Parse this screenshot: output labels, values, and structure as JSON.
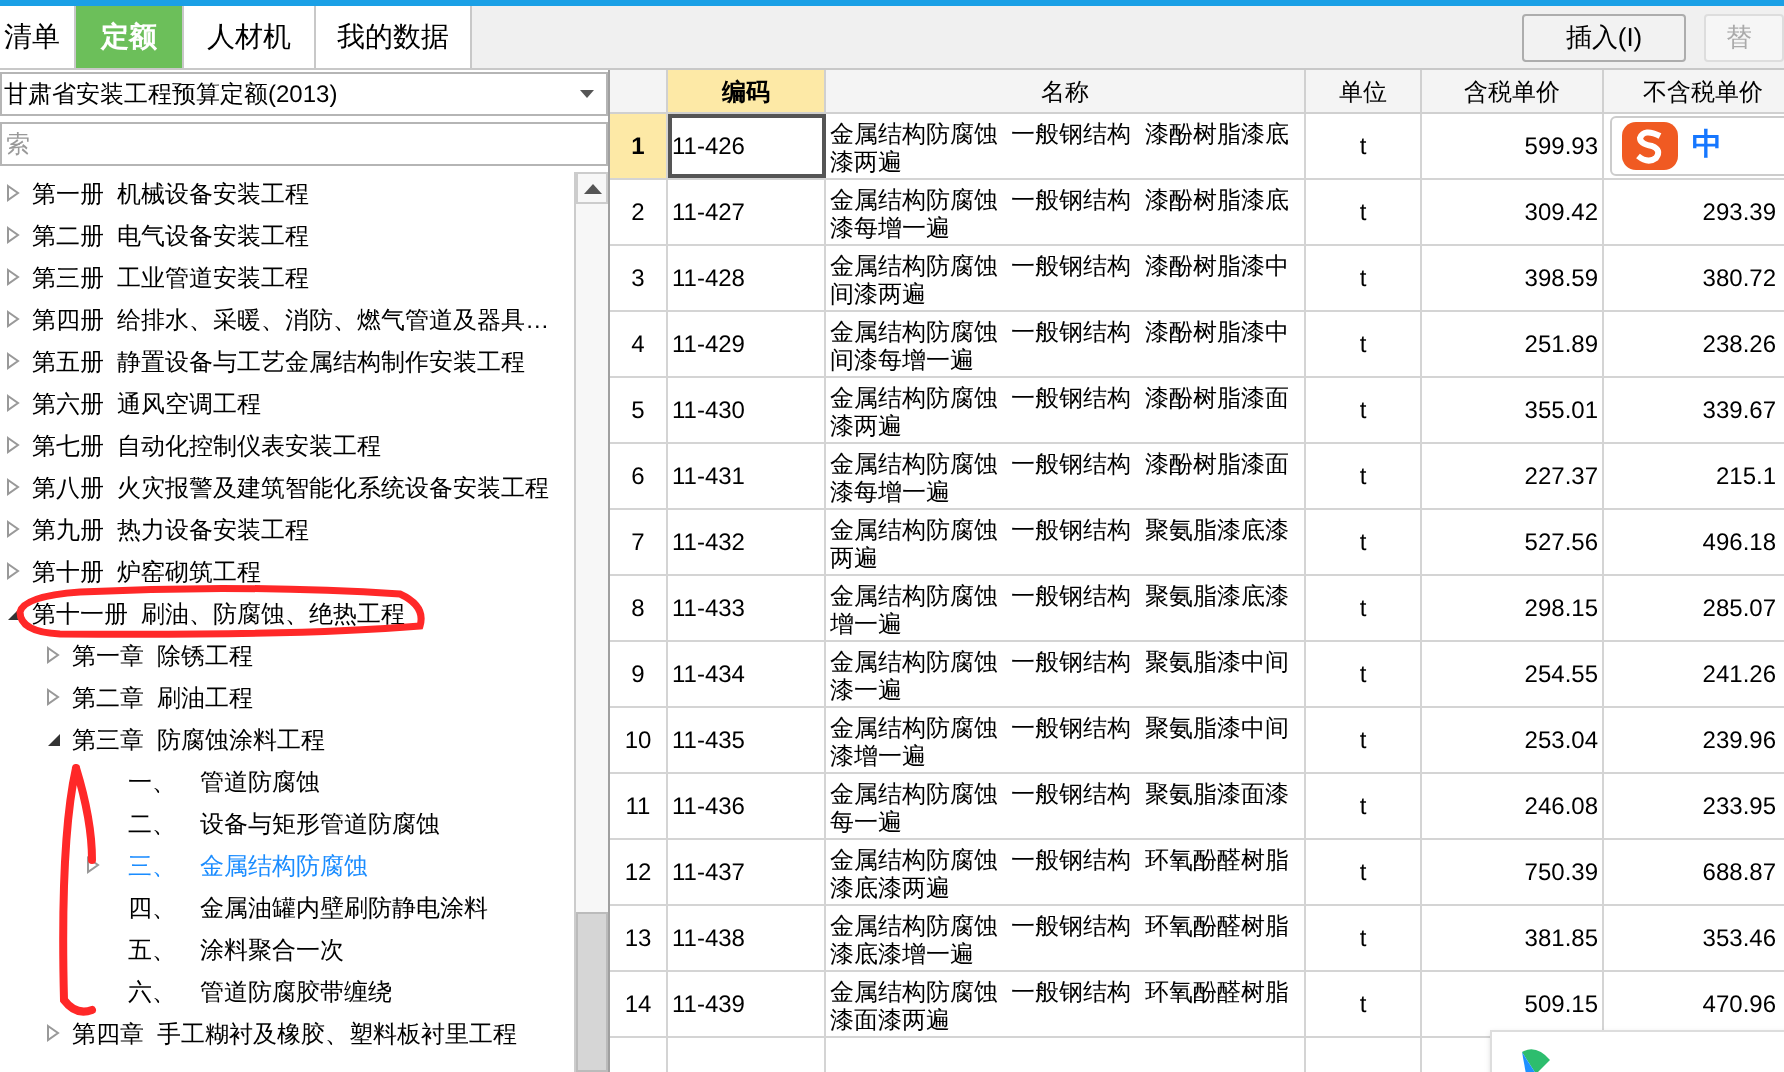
{
  "tabs": [
    {
      "label": "清单",
      "selected": false
    },
    {
      "label": "定额",
      "selected": true
    },
    {
      "label": "人材机",
      "selected": false
    },
    {
      "label": "我的数据",
      "selected": false
    }
  ],
  "toolbar": {
    "buttons": [
      {
        "label": "插入(I)",
        "disabled": false
      },
      {
        "label": "替",
        "disabled": true
      }
    ]
  },
  "library_select": {
    "value": "甘肃省安装工程预算定额(2013)"
  },
  "search": {
    "placeholder": "索"
  },
  "tree": [
    {
      "label": "第一册  机械设备安装工程",
      "expanded": false,
      "selected": false
    },
    {
      "label": "第二册  电气设备安装工程",
      "expanded": false,
      "selected": false
    },
    {
      "label": "第三册  工业管道安装工程",
      "expanded": false,
      "selected": false
    },
    {
      "label": "第四册  给排水、采暖、消防、燃气管道及器具…",
      "expanded": false,
      "selected": false
    },
    {
      "label": "第五册  静置设备与工艺金属结构制作安装工程",
      "expanded": false,
      "selected": false
    },
    {
      "label": "第六册  通风空调工程",
      "expanded": false,
      "selected": false
    },
    {
      "label": "第七册  自动化控制仪表安装工程",
      "expanded": false,
      "selected": false
    },
    {
      "label": "第八册  火灾报警及建筑智能化系统设备安装工程",
      "expanded": false,
      "selected": false
    },
    {
      "label": "第九册  热力设备安装工程",
      "expanded": false,
      "selected": false
    },
    {
      "label": "第十册  炉窑砌筑工程",
      "expanded": false,
      "selected": false
    },
    {
      "label": "第十一册  刷油、防腐蚀、绝热工程",
      "expanded": true,
      "selected": false,
      "children": [
        {
          "label": "第一章  除锈工程",
          "expanded": false,
          "selected": false
        },
        {
          "label": "第二章  刷油工程",
          "expanded": false,
          "selected": false
        },
        {
          "label": "第三章  防腐蚀涂料工程",
          "expanded": true,
          "selected": false,
          "children": [
            {
              "number": "一、",
              "label": "管道防腐蚀",
              "selected": false
            },
            {
              "number": "二、",
              "label": "设备与矩形管道防腐蚀",
              "selected": false
            },
            {
              "number": "三、",
              "label": "金属结构防腐蚀",
              "expanded": false,
              "selected": true
            },
            {
              "number": "四、",
              "label": "金属油罐内壁刷防静电涂料",
              "selected": false
            },
            {
              "number": "五、",
              "label": "涂料聚合一次",
              "selected": false
            },
            {
              "number": "六、",
              "label": "管道防腐胶带缠绕",
              "selected": false
            }
          ]
        },
        {
          "label": "第四章  手工糊衬及橡胶、塑料板衬里工程",
          "expanded": false,
          "selected": false
        }
      ]
    }
  ],
  "table": {
    "columns": [
      "编码",
      "名称",
      "单位",
      "含税单价",
      "不含税单价"
    ],
    "rows": [
      {
        "index": "1",
        "code": "11-426",
        "name": "金属结构防腐蚀  一般钢结构  漆酚树脂漆底漆两遍",
        "unit": "t",
        "price_tax": "599.93",
        "price_notax": "",
        "selected": true
      },
      {
        "index": "2",
        "code": "11-427",
        "name": "金属结构防腐蚀  一般钢结构  漆酚树脂漆底漆每增一遍",
        "unit": "t",
        "price_tax": "309.42",
        "price_notax": "293.39",
        "selected": false
      },
      {
        "index": "3",
        "code": "11-428",
        "name": "金属结构防腐蚀  一般钢结构  漆酚树脂漆中间漆两遍",
        "unit": "t",
        "price_tax": "398.59",
        "price_notax": "380.72",
        "selected": false
      },
      {
        "index": "4",
        "code": "11-429",
        "name": "金属结构防腐蚀  一般钢结构  漆酚树脂漆中间漆每增一遍",
        "unit": "t",
        "price_tax": "251.89",
        "price_notax": "238.26",
        "selected": false
      },
      {
        "index": "5",
        "code": "11-430",
        "name": "金属结构防腐蚀  一般钢结构  漆酚树脂漆面漆两遍",
        "unit": "t",
        "price_tax": "355.01",
        "price_notax": "339.67",
        "selected": false
      },
      {
        "index": "6",
        "code": "11-431",
        "name": "金属结构防腐蚀  一般钢结构  漆酚树脂漆面漆每增一遍",
        "unit": "t",
        "price_tax": "227.37",
        "price_notax": "215.1",
        "selected": false
      },
      {
        "index": "7",
        "code": "11-432",
        "name": "金属结构防腐蚀  一般钢结构  聚氨脂漆底漆两遍",
        "unit": "t",
        "price_tax": "527.56",
        "price_notax": "496.18",
        "selected": false
      },
      {
        "index": "8",
        "code": "11-433",
        "name": "金属结构防腐蚀  一般钢结构  聚氨脂漆底漆增一遍",
        "unit": "t",
        "price_tax": "298.15",
        "price_notax": "285.07",
        "selected": false
      },
      {
        "index": "9",
        "code": "11-434",
        "name": "金属结构防腐蚀  一般钢结构  聚氨脂漆中间漆一遍",
        "unit": "t",
        "price_tax": "254.55",
        "price_notax": "241.26",
        "selected": false
      },
      {
        "index": "10",
        "code": "11-435",
        "name": "金属结构防腐蚀  一般钢结构  聚氨脂漆中间漆增一遍",
        "unit": "t",
        "price_tax": "253.04",
        "price_notax": "239.96",
        "selected": false
      },
      {
        "index": "11",
        "code": "11-436",
        "name": "金属结构防腐蚀  一般钢结构  聚氨脂漆面漆每一遍",
        "unit": "t",
        "price_tax": "246.08",
        "price_notax": "233.95",
        "selected": false
      },
      {
        "index": "12",
        "code": "11-437",
        "name": "金属结构防腐蚀  一般钢结构  环氧酚醛树脂漆底漆两遍",
        "unit": "t",
        "price_tax": "750.39",
        "price_notax": "688.87",
        "selected": false
      },
      {
        "index": "13",
        "code": "11-438",
        "name": "金属结构防腐蚀  一般钢结构  环氧酚醛树脂漆底漆增一遍",
        "unit": "t",
        "price_tax": "381.85",
        "price_notax": "353.46",
        "selected": false
      },
      {
        "index": "14",
        "code": "11-439",
        "name": "金属结构防腐蚀  一般钢结构  环氧酚醛树脂漆面漆两遍",
        "unit": "t",
        "price_tax": "509.15",
        "price_notax": "470.96",
        "selected": false
      }
    ]
  },
  "ime_bar": {
    "mode": "中"
  }
}
